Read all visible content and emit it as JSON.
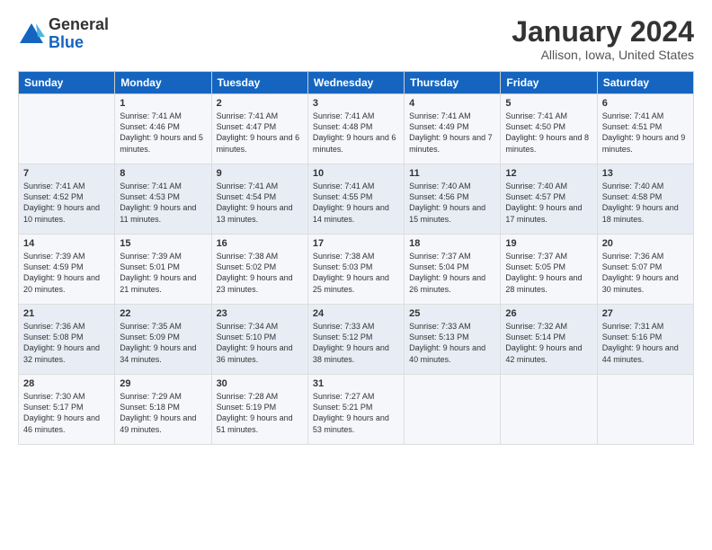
{
  "header": {
    "logo_general": "General",
    "logo_blue": "Blue",
    "month_title": "January 2024",
    "location": "Allison, Iowa, United States"
  },
  "weekdays": [
    "Sunday",
    "Monday",
    "Tuesday",
    "Wednesday",
    "Thursday",
    "Friday",
    "Saturday"
  ],
  "weeks": [
    [
      {
        "day": "",
        "sunrise": "",
        "sunset": "",
        "daylight": ""
      },
      {
        "day": "1",
        "sunrise": "Sunrise: 7:41 AM",
        "sunset": "Sunset: 4:46 PM",
        "daylight": "Daylight: 9 hours and 5 minutes."
      },
      {
        "day": "2",
        "sunrise": "Sunrise: 7:41 AM",
        "sunset": "Sunset: 4:47 PM",
        "daylight": "Daylight: 9 hours and 6 minutes."
      },
      {
        "day": "3",
        "sunrise": "Sunrise: 7:41 AM",
        "sunset": "Sunset: 4:48 PM",
        "daylight": "Daylight: 9 hours and 6 minutes."
      },
      {
        "day": "4",
        "sunrise": "Sunrise: 7:41 AM",
        "sunset": "Sunset: 4:49 PM",
        "daylight": "Daylight: 9 hours and 7 minutes."
      },
      {
        "day": "5",
        "sunrise": "Sunrise: 7:41 AM",
        "sunset": "Sunset: 4:50 PM",
        "daylight": "Daylight: 9 hours and 8 minutes."
      },
      {
        "day": "6",
        "sunrise": "Sunrise: 7:41 AM",
        "sunset": "Sunset: 4:51 PM",
        "daylight": "Daylight: 9 hours and 9 minutes."
      }
    ],
    [
      {
        "day": "7",
        "sunrise": "Sunrise: 7:41 AM",
        "sunset": "Sunset: 4:52 PM",
        "daylight": "Daylight: 9 hours and 10 minutes."
      },
      {
        "day": "8",
        "sunrise": "Sunrise: 7:41 AM",
        "sunset": "Sunset: 4:53 PM",
        "daylight": "Daylight: 9 hours and 11 minutes."
      },
      {
        "day": "9",
        "sunrise": "Sunrise: 7:41 AM",
        "sunset": "Sunset: 4:54 PM",
        "daylight": "Daylight: 9 hours and 13 minutes."
      },
      {
        "day": "10",
        "sunrise": "Sunrise: 7:41 AM",
        "sunset": "Sunset: 4:55 PM",
        "daylight": "Daylight: 9 hours and 14 minutes."
      },
      {
        "day": "11",
        "sunrise": "Sunrise: 7:40 AM",
        "sunset": "Sunset: 4:56 PM",
        "daylight": "Daylight: 9 hours and 15 minutes."
      },
      {
        "day": "12",
        "sunrise": "Sunrise: 7:40 AM",
        "sunset": "Sunset: 4:57 PM",
        "daylight": "Daylight: 9 hours and 17 minutes."
      },
      {
        "day": "13",
        "sunrise": "Sunrise: 7:40 AM",
        "sunset": "Sunset: 4:58 PM",
        "daylight": "Daylight: 9 hours and 18 minutes."
      }
    ],
    [
      {
        "day": "14",
        "sunrise": "Sunrise: 7:39 AM",
        "sunset": "Sunset: 4:59 PM",
        "daylight": "Daylight: 9 hours and 20 minutes."
      },
      {
        "day": "15",
        "sunrise": "Sunrise: 7:39 AM",
        "sunset": "Sunset: 5:01 PM",
        "daylight": "Daylight: 9 hours and 21 minutes."
      },
      {
        "day": "16",
        "sunrise": "Sunrise: 7:38 AM",
        "sunset": "Sunset: 5:02 PM",
        "daylight": "Daylight: 9 hours and 23 minutes."
      },
      {
        "day": "17",
        "sunrise": "Sunrise: 7:38 AM",
        "sunset": "Sunset: 5:03 PM",
        "daylight": "Daylight: 9 hours and 25 minutes."
      },
      {
        "day": "18",
        "sunrise": "Sunrise: 7:37 AM",
        "sunset": "Sunset: 5:04 PM",
        "daylight": "Daylight: 9 hours and 26 minutes."
      },
      {
        "day": "19",
        "sunrise": "Sunrise: 7:37 AM",
        "sunset": "Sunset: 5:05 PM",
        "daylight": "Daylight: 9 hours and 28 minutes."
      },
      {
        "day": "20",
        "sunrise": "Sunrise: 7:36 AM",
        "sunset": "Sunset: 5:07 PM",
        "daylight": "Daylight: 9 hours and 30 minutes."
      }
    ],
    [
      {
        "day": "21",
        "sunrise": "Sunrise: 7:36 AM",
        "sunset": "Sunset: 5:08 PM",
        "daylight": "Daylight: 9 hours and 32 minutes."
      },
      {
        "day": "22",
        "sunrise": "Sunrise: 7:35 AM",
        "sunset": "Sunset: 5:09 PM",
        "daylight": "Daylight: 9 hours and 34 minutes."
      },
      {
        "day": "23",
        "sunrise": "Sunrise: 7:34 AM",
        "sunset": "Sunset: 5:10 PM",
        "daylight": "Daylight: 9 hours and 36 minutes."
      },
      {
        "day": "24",
        "sunrise": "Sunrise: 7:33 AM",
        "sunset": "Sunset: 5:12 PM",
        "daylight": "Daylight: 9 hours and 38 minutes."
      },
      {
        "day": "25",
        "sunrise": "Sunrise: 7:33 AM",
        "sunset": "Sunset: 5:13 PM",
        "daylight": "Daylight: 9 hours and 40 minutes."
      },
      {
        "day": "26",
        "sunrise": "Sunrise: 7:32 AM",
        "sunset": "Sunset: 5:14 PM",
        "daylight": "Daylight: 9 hours and 42 minutes."
      },
      {
        "day": "27",
        "sunrise": "Sunrise: 7:31 AM",
        "sunset": "Sunset: 5:16 PM",
        "daylight": "Daylight: 9 hours and 44 minutes."
      }
    ],
    [
      {
        "day": "28",
        "sunrise": "Sunrise: 7:30 AM",
        "sunset": "Sunset: 5:17 PM",
        "daylight": "Daylight: 9 hours and 46 minutes."
      },
      {
        "day": "29",
        "sunrise": "Sunrise: 7:29 AM",
        "sunset": "Sunset: 5:18 PM",
        "daylight": "Daylight: 9 hours and 49 minutes."
      },
      {
        "day": "30",
        "sunrise": "Sunrise: 7:28 AM",
        "sunset": "Sunset: 5:19 PM",
        "daylight": "Daylight: 9 hours and 51 minutes."
      },
      {
        "day": "31",
        "sunrise": "Sunrise: 7:27 AM",
        "sunset": "Sunset: 5:21 PM",
        "daylight": "Daylight: 9 hours and 53 minutes."
      },
      {
        "day": "",
        "sunrise": "",
        "sunset": "",
        "daylight": ""
      },
      {
        "day": "",
        "sunrise": "",
        "sunset": "",
        "daylight": ""
      },
      {
        "day": "",
        "sunrise": "",
        "sunset": "",
        "daylight": ""
      }
    ]
  ]
}
